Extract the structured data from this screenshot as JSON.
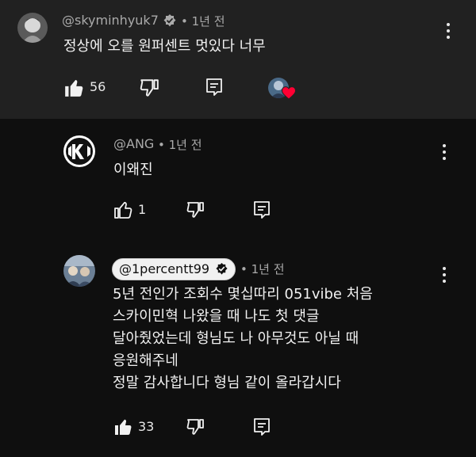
{
  "comment": {
    "handle": "@skyminhyuk7",
    "time": "1년 전",
    "text": "정상에 오를 원퍼센트 멋있다 너무",
    "likes": "56"
  },
  "reply1": {
    "handle": "@ANG",
    "time": "1년 전",
    "text": "이왜진",
    "likes": "1"
  },
  "reply2": {
    "handle": "@1percentt99",
    "time": "1년 전",
    "lines": [
      "5년 전인가 조회수 몇십따리 051vibe 처음",
      "스카이민혁 나왔을 때 나도 첫 댓글",
      "달아줬었는데 형님도 나 아무것도 아닐 때",
      "응원해주네",
      "정말 감사합니다 형님 같이 올라갑시다"
    ],
    "likes": "33"
  },
  "icons": {
    "like": "thumbs-up-icon",
    "dislike": "thumbs-down-icon",
    "reply": "reply-icon",
    "more": "more-vertical-icon",
    "verified": "verified-check-icon",
    "heart": "creator-heart-icon"
  },
  "colors": {
    "heart": "#ff0033",
    "background": "#0f0f0f",
    "highlight": "#212121"
  }
}
